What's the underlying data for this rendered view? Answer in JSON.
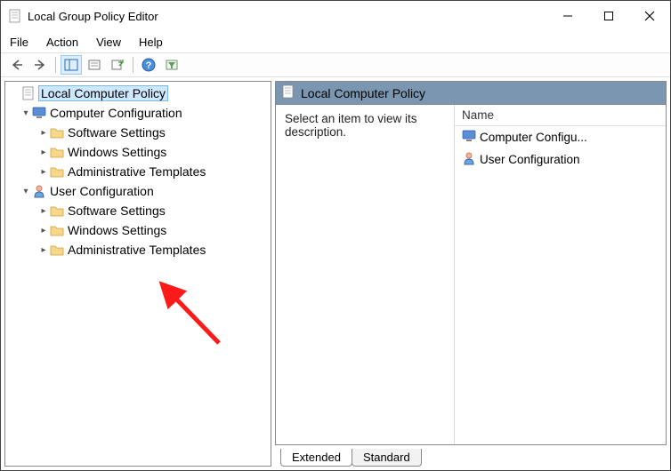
{
  "window": {
    "title": "Local Group Policy Editor"
  },
  "menubar": [
    "File",
    "Action",
    "View",
    "Help"
  ],
  "tree": {
    "root": "Local Computer Policy",
    "computer_config": "Computer Configuration",
    "user_config": "User Configuration",
    "software_settings": "Software Settings",
    "windows_settings": "Windows Settings",
    "admin_templates": "Administrative Templates"
  },
  "content": {
    "header": "Local Computer Policy",
    "description": "Select an item to view its description.",
    "list_header": "Name",
    "items": [
      {
        "label": "Computer Configu...",
        "icon": "computer"
      },
      {
        "label": "User Configuration",
        "icon": "user"
      }
    ]
  },
  "tabs": {
    "extended": "Extended",
    "standard": "Standard"
  }
}
